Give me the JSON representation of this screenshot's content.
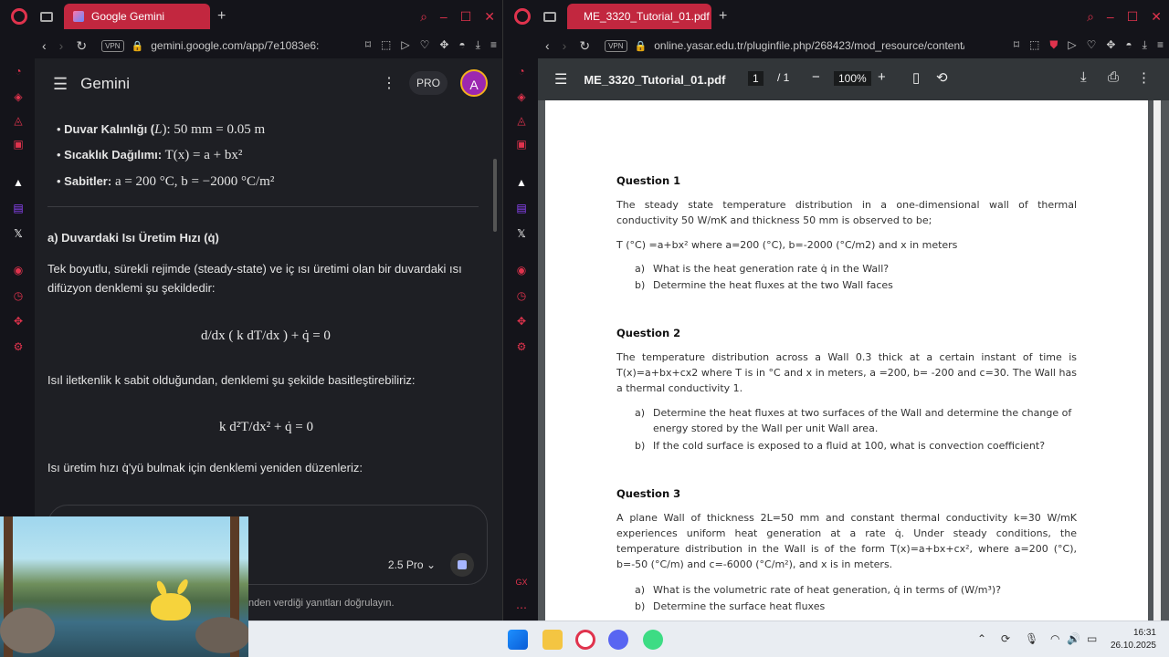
{
  "left_window": {
    "tab_title": "Google Gemini",
    "url": "gemini.google.com/app/7e1083e6:",
    "vpn": "VPN",
    "app_name": "Gemini",
    "pro_badge": "PRO",
    "avatar_letter": "A",
    "model": "2.5 Pro",
    "disclaimer": "nden verdiği yanıtları doğrulayın.",
    "bullets": [
      {
        "label": "Duvar Kalınlığı (",
        "sym": "L",
        "rest": "): 50 mm = 0.05 m"
      },
      {
        "label": "Sıcaklık Dağılımı:",
        "sym": "",
        "rest": " T(x) = a + bx²"
      },
      {
        "label": "Sabitler:",
        "sym": "",
        "rest": " a = 200 °C, b = −2000 °C/m²"
      }
    ],
    "section_heading": "a) Duvardaki Isı Üretim Hızı (q̇)",
    "para1": "Tek boyutlu, sürekli rejimde (steady-state) ve iç ısı üretimi olan bir duvardaki ısı difüzyon denklemi şu şekildedir:",
    "eq1": "d/dx ( k dT/dx ) + q̇ = 0",
    "para2": "Isıl iletkenlik k sabit olduğundan, denklemi şu şekilde basitleştirebiliriz:",
    "eq2": "k d²T/dx² + q̇ = 0",
    "para3": "Isı üretim hızı q̇'yü bulmak için denklemi yeniden düzenleriz:"
  },
  "right_window": {
    "tab_title": "ME_3320_Tutorial_01.pdf",
    "url": "online.yasar.edu.tr/pluginfile.php/268423/mod_resource/content/",
    "vpn": "VPN",
    "pdf_title": "ME_3320_Tutorial_01.pdf",
    "page_current": "1",
    "page_total": "/ 1",
    "zoom": "100%",
    "questions": [
      {
        "heading": "Question 1",
        "text": "The steady state temperature distribution in a one-dimensional wall of thermal conductivity 50 W/mK and thickness 50 mm is observed to be;",
        "text2": "T (°C) =a+bx² where a=200 (°C), b=-2000 (°C/m2) and x in meters",
        "items": [
          {
            "label": "a)",
            "text": "What is the heat generation rate q̇ in the Wall?"
          },
          {
            "label": "b)",
            "text": "Determine the heat fluxes at the two Wall faces"
          }
        ]
      },
      {
        "heading": "Question 2",
        "text": "The temperature distribution across a Wall 0.3 thick at a certain instant of time is T(x)=a+bx+cx2 where T is in °C and x in meters, a =200, b= -200 and c=30. The Wall has a thermal conductivity 1.",
        "items": [
          {
            "label": "a)",
            "text": "Determine the heat fluxes at two surfaces of the Wall and determine the change of energy stored by the Wall per unit Wall area."
          },
          {
            "label": "b)",
            "text": "If the cold surface is exposed to a fluid at 100, what is convection coefficient?"
          }
        ]
      },
      {
        "heading": "Question 3",
        "text": "A plane Wall of thickness 2L=50 mm and constant thermal conductivity k=30 W/mK experiences uniform heat generation at a rate q̇. Under steady conditions, the temperature distribution in the Wall is of the form T(x)=a+bx+cx², where a=200 (°C), b=-50 (°C/m) and c=-6000 (°C/m²), and x is in meters.",
        "items": [
          {
            "label": "a)",
            "text": "What is the volumetric rate of heat generation, q̇ in terms of (W/m³)?"
          },
          {
            "label": "b)",
            "text": "Determine the surface heat fluxes"
          }
        ]
      }
    ]
  },
  "taskbar": {
    "time": "16:31",
    "date": "26.10.2025"
  },
  "colors": {
    "opera_red": "#e0334d",
    "tab_red": "#c2273f",
    "gemini_bg": "#1e1f24",
    "pdf_toolbar": "#323639"
  }
}
